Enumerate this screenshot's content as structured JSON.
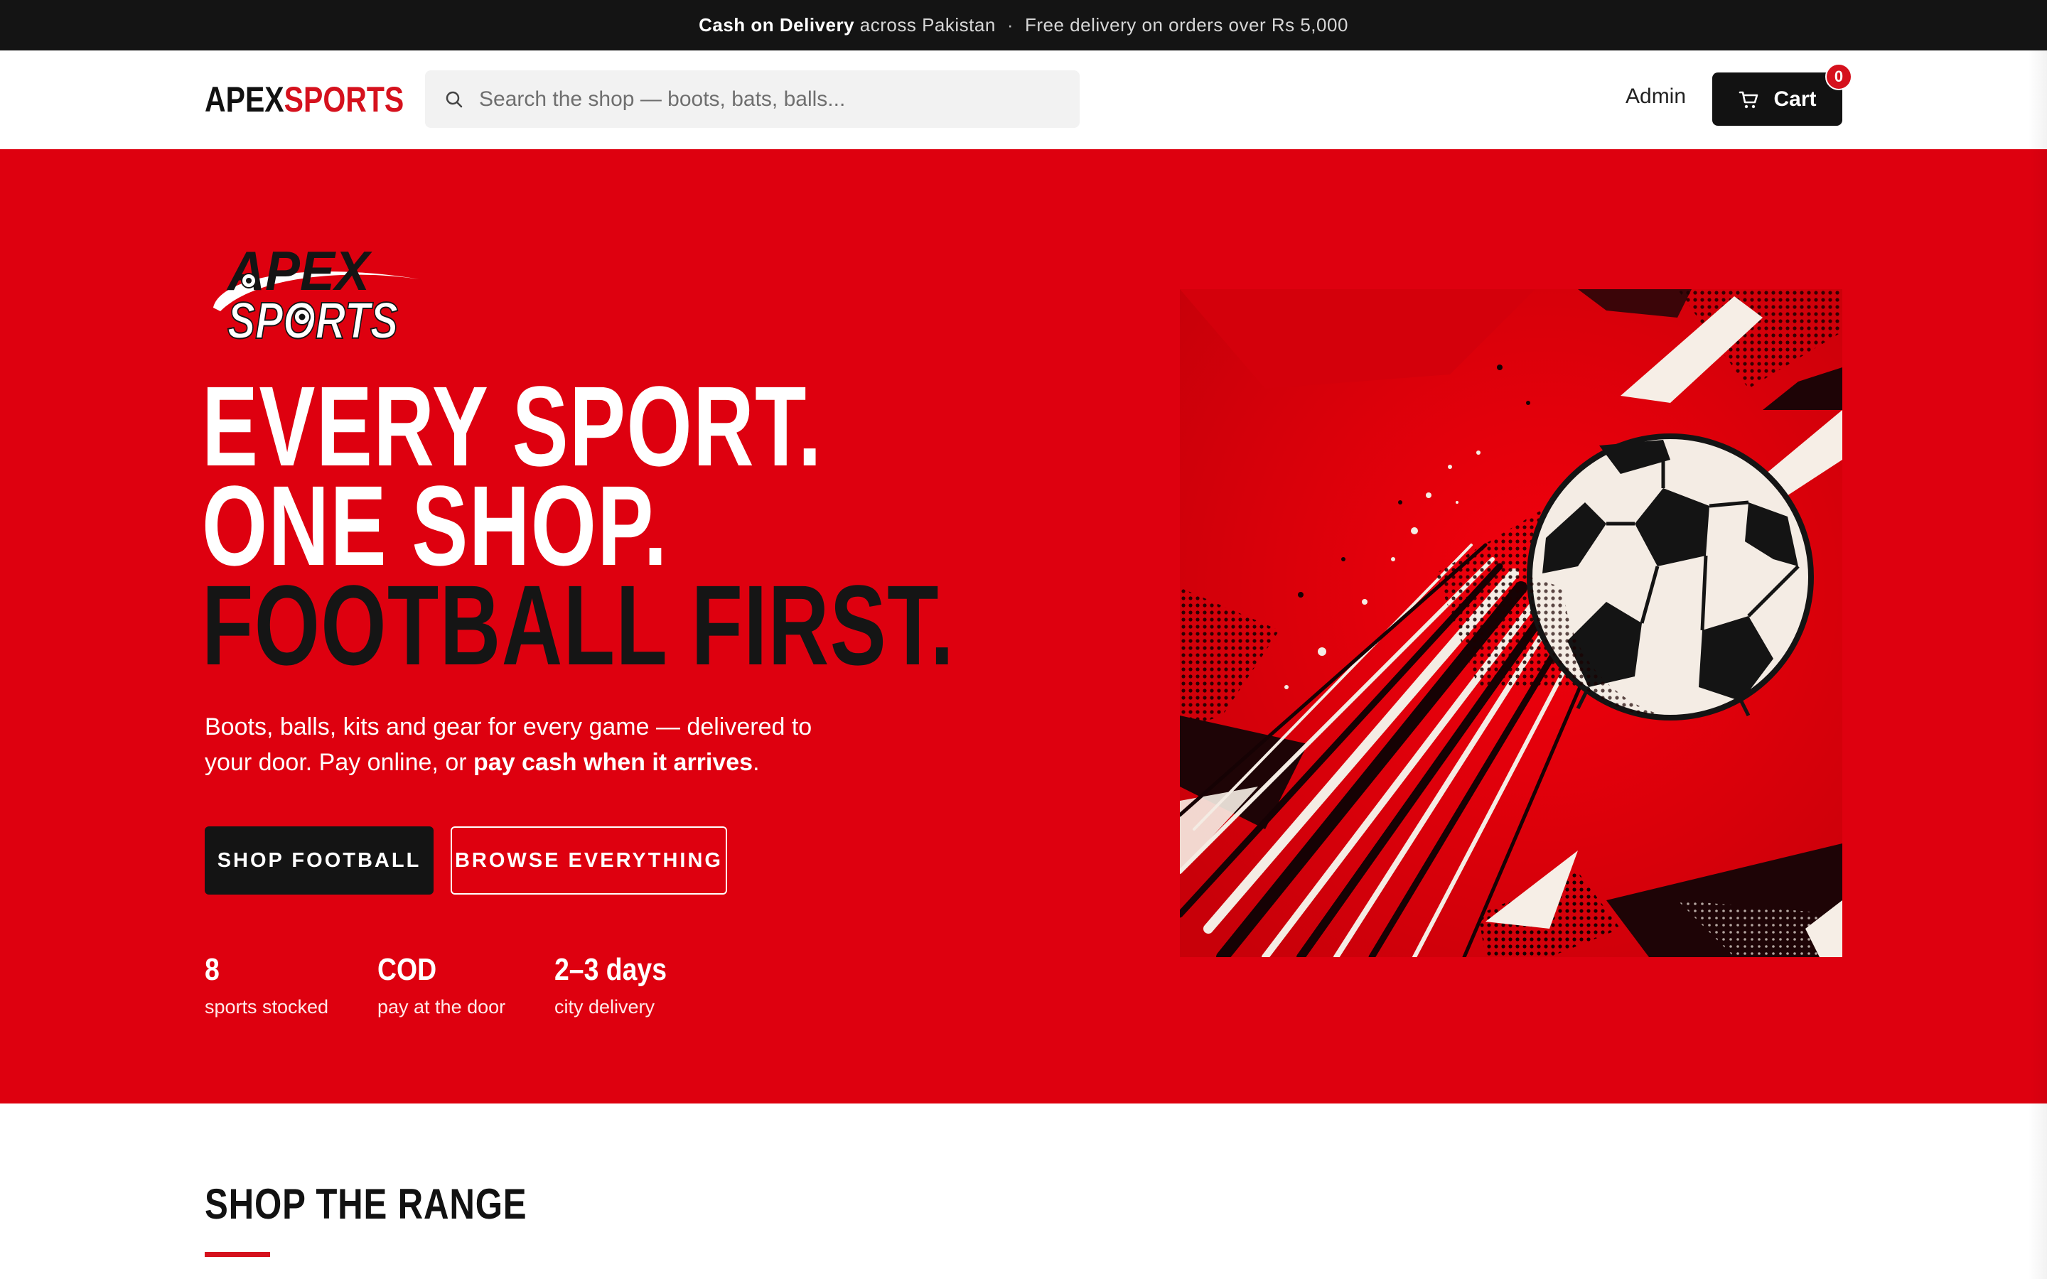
{
  "announcement": {
    "strong": "Cash on Delivery",
    "text": " across Pakistan",
    "separator": "·",
    "right": "Free delivery on orders over Rs 5,000"
  },
  "header": {
    "logo_part1": "APEX",
    "logo_part2": "SPORTS",
    "search_placeholder": "Search the shop — boots, bats, balls...",
    "admin_label": "Admin",
    "cart_label": "Cart",
    "cart_count": "0"
  },
  "hero": {
    "logo_line1": "APEX",
    "logo_line2": "SPORTS",
    "headline": [
      "EVERY SPORT.",
      "ONE SHOP.",
      "FOOTBALL FIRST."
    ],
    "sub_text": "Boots, balls, kits and gear for every game — delivered to your door. Pay online, or ",
    "sub_bold": "pay cash when it arrives",
    "sub_end": ".",
    "primary_button": "SHOP FOOTBALL",
    "secondary_button": "BROWSE EVERYTHING",
    "stats": [
      {
        "value": "8",
        "label": "sports stocked"
      },
      {
        "value": "COD",
        "label": "pay at the door"
      },
      {
        "value": "2–3 days",
        "label": "city delivery"
      }
    ]
  },
  "section": {
    "title": "SHOP THE RANGE"
  },
  "colors": {
    "brand_red": "#de000f",
    "dark": "#141414",
    "white": "#ffffff"
  },
  "icons": [
    "search-icon",
    "cart-icon",
    "football-icon"
  ]
}
